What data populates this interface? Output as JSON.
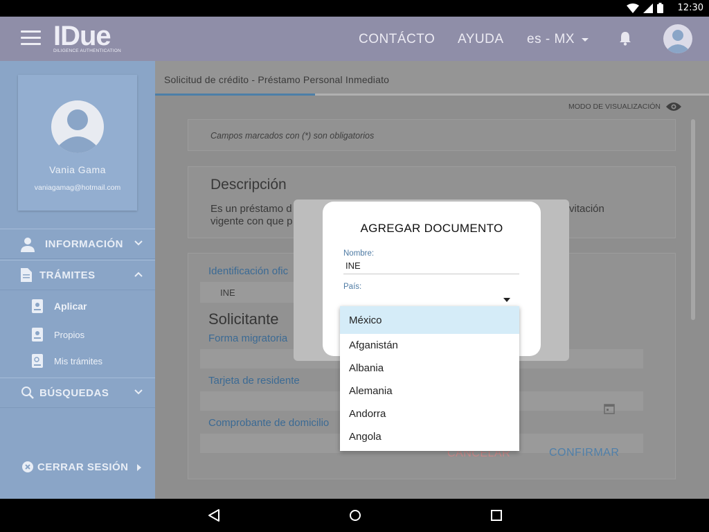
{
  "status_bar": {
    "time": "12:30"
  },
  "header": {
    "logo_text": "IDue",
    "logo_subtitle": "DILIGENCE AUTHENTICATION",
    "nav_contact": "CONTÁCTO",
    "nav_help": "AYUDA",
    "language": "es - MX"
  },
  "sidebar": {
    "user_name": "Vania Gama",
    "user_email": "vaniagamag@hotmail.com",
    "menu": {
      "info": "INFORMACIÓN",
      "tramites": "TRÁMITES",
      "sub_aplicar": "Aplicar",
      "sub_propios": "Propios",
      "sub_mis": "Mis trámites",
      "busquedas": "BÚSQUEDAS",
      "logout": "CERRAR SESIÓN"
    }
  },
  "main": {
    "breadcrumb": "Solicitud de crédito  - Préstamo Personal Inmediato",
    "view_mode": "MODO DE VISUALIZACIÓN",
    "required_note": "Campos marcados con (*) son obligatorios",
    "description_title": "Descripción",
    "description_line1": "Es un préstamo d",
    "description_line2": "vigente con que p",
    "description_right": "vitación",
    "id_label": "Identificación ofic",
    "id_value": "INE",
    "applicant_title": "Solicitante",
    "migratory_label": "Forma migratoria",
    "resident_label": "Tarjeta de residente",
    "address_label": "Comprobante de domicilio",
    "cancel": "CANCELAR",
    "confirm": "CONFIRMAR"
  },
  "dialog": {
    "title": "AGREGAR DOCUMENTO",
    "name_label": "Nombre:",
    "name_value": "INE",
    "country_label": "País:"
  },
  "dropdown": {
    "options": [
      "México",
      "Afganistán",
      "Albania",
      "Alemania",
      "Andorra",
      "Angola"
    ],
    "selected": "México"
  },
  "colors": {
    "header": "#8f8ea8",
    "sidebar": "#8aa5c7",
    "link_blue": "#3b6a94",
    "selected_option": "#d5ecf8",
    "cancel_red": "#c98a8a"
  }
}
